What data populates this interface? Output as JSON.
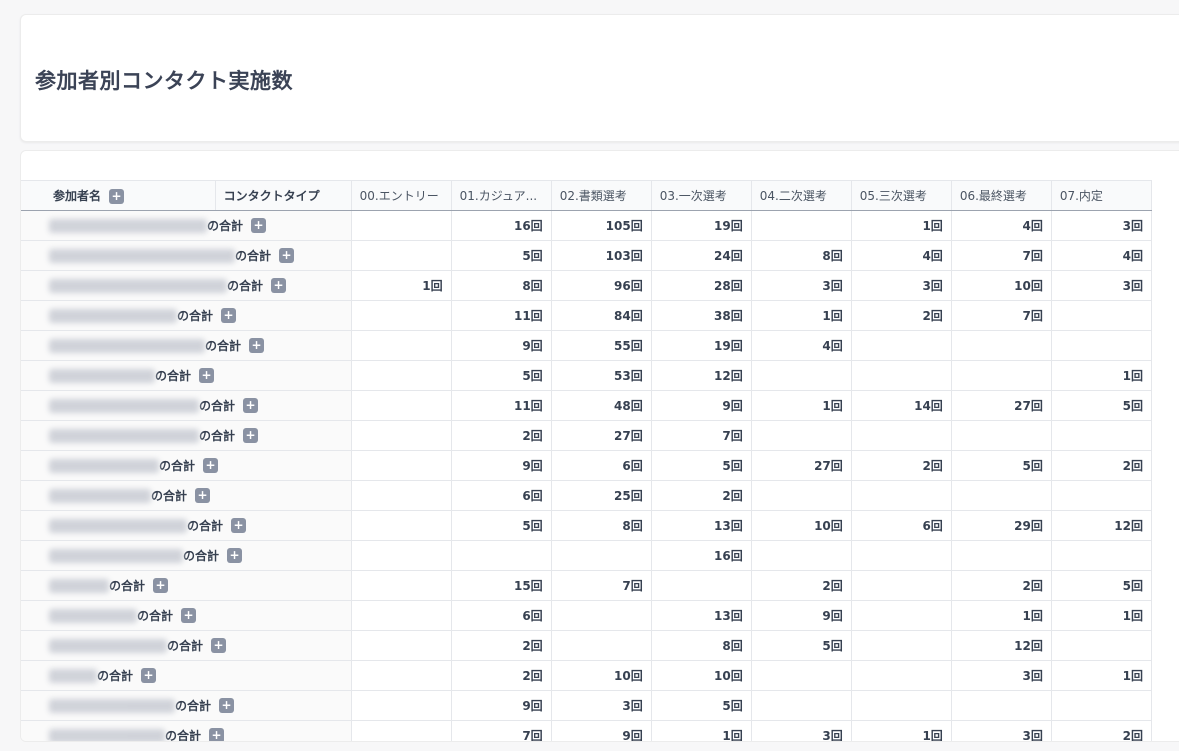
{
  "page_title": "参加者別コンタクト実施数",
  "headers": {
    "participant": "参加者名",
    "contact_type": "コンタクトタイプ",
    "stages": [
      "00.エントリー",
      "01.カジュア...",
      "02.書類選考",
      "03.一次選考",
      "04.二次選考",
      "05.三次選考",
      "06.最終選考",
      "07.内定"
    ]
  },
  "total_suffix": "の合計",
  "expand_label": "+",
  "rows": [
    {
      "values": [
        "",
        "16回",
        "105回",
        "19回",
        "",
        "1回",
        "4回",
        "3回"
      ]
    },
    {
      "values": [
        "",
        "5回",
        "103回",
        "24回",
        "8回",
        "4回",
        "7回",
        "4回"
      ]
    },
    {
      "values": [
        "1回",
        "8回",
        "96回",
        "28回",
        "3回",
        "3回",
        "10回",
        "3回"
      ]
    },
    {
      "values": [
        "",
        "11回",
        "84回",
        "38回",
        "1回",
        "2回",
        "7回",
        ""
      ]
    },
    {
      "values": [
        "",
        "9回",
        "55回",
        "19回",
        "4回",
        "",
        "",
        ""
      ]
    },
    {
      "values": [
        "",
        "5回",
        "53回",
        "12回",
        "",
        "",
        "",
        "1回"
      ]
    },
    {
      "values": [
        "",
        "11回",
        "48回",
        "9回",
        "1回",
        "14回",
        "27回",
        "5回"
      ]
    },
    {
      "values": [
        "",
        "2回",
        "27回",
        "7回",
        "",
        "",
        "",
        ""
      ]
    },
    {
      "values": [
        "",
        "9回",
        "6回",
        "5回",
        "27回",
        "2回",
        "5回",
        "2回"
      ]
    },
    {
      "values": [
        "",
        "6回",
        "25回",
        "2回",
        "",
        "",
        "",
        ""
      ]
    },
    {
      "values": [
        "",
        "5回",
        "8回",
        "13回",
        "10回",
        "6回",
        "29回",
        "12回"
      ]
    },
    {
      "values": [
        "",
        "",
        "",
        "16回",
        "",
        "",
        "",
        ""
      ]
    },
    {
      "values": [
        "",
        "15回",
        "7回",
        "",
        "2回",
        "",
        "2回",
        "5回"
      ]
    },
    {
      "values": [
        "",
        "6回",
        "",
        "13回",
        "9回",
        "",
        "1回",
        "1回"
      ]
    },
    {
      "values": [
        "",
        "2回",
        "",
        "8回",
        "5回",
        "",
        "12回",
        ""
      ]
    },
    {
      "values": [
        "",
        "2回",
        "10回",
        "10回",
        "",
        "",
        "3回",
        "1回"
      ]
    },
    {
      "values": [
        "",
        "9回",
        "3回",
        "5回",
        "",
        "",
        "",
        ""
      ]
    },
    {
      "values": [
        "",
        "7回",
        "9回",
        "1回",
        "3回",
        "1回",
        "3回",
        "2回"
      ]
    }
  ]
}
